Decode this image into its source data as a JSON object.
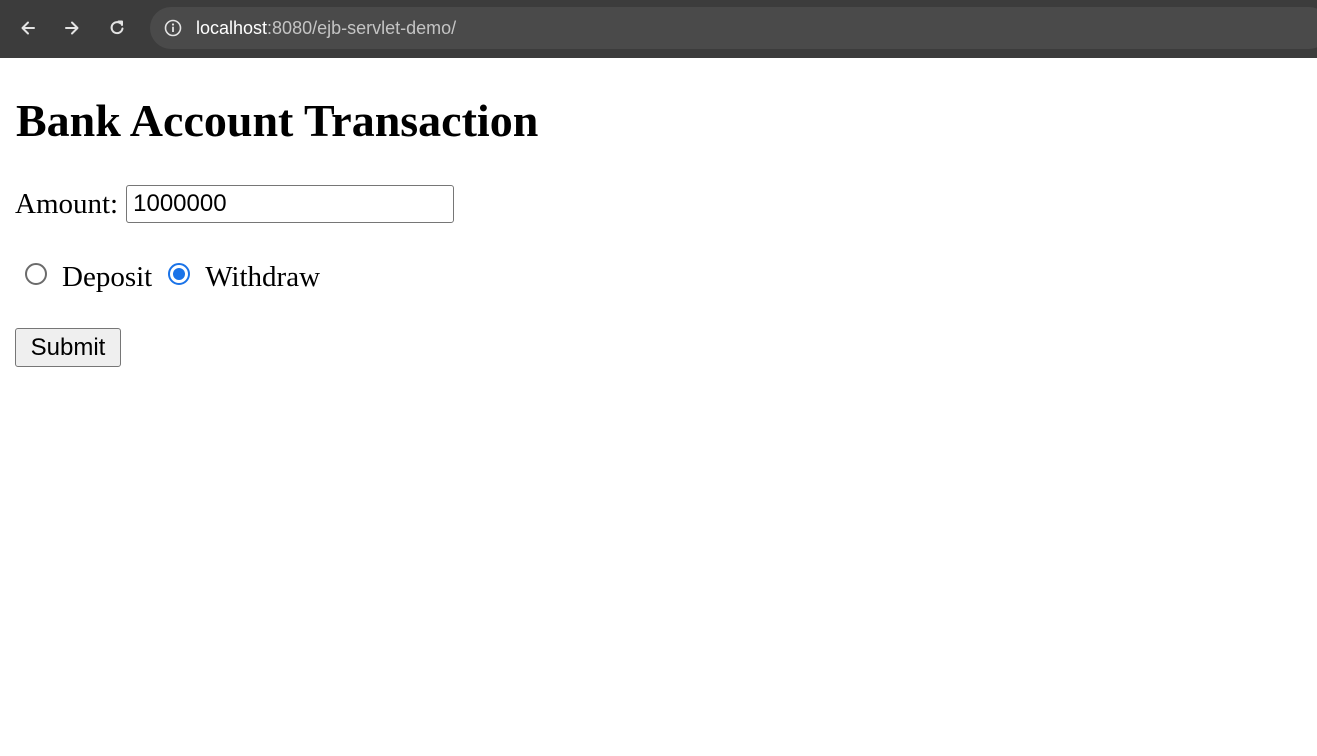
{
  "browser": {
    "url_host": "localhost",
    "url_path": ":8080/ejb-servlet-demo/",
    "icons": {
      "back": "arrow-left-icon",
      "forward": "arrow-right-icon",
      "reload": "reload-icon",
      "site_info": "info-icon"
    },
    "colors": {
      "toolbar": "#3c3c3c",
      "omnibox": "#4a4a4a"
    }
  },
  "page": {
    "title": "Bank Account Transaction",
    "form": {
      "amount_label": "Amount:",
      "amount_value": "1000000",
      "options": [
        {
          "label": "Deposit",
          "checked": false
        },
        {
          "label": "Withdraw",
          "checked": true
        }
      ],
      "submit_label": "Submit"
    },
    "colors": {
      "radio_selected": "#1a73e8"
    }
  }
}
